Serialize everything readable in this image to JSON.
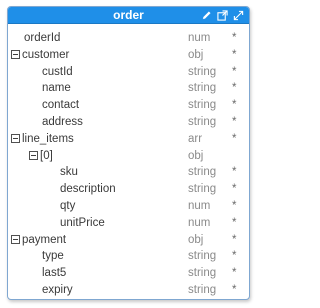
{
  "node": {
    "title": "order",
    "title_bg": "#1f8fe8",
    "border_color": "#7fa7d1",
    "toolbar_icons": [
      "pencil-icon",
      "external-link-icon",
      "expand-icon"
    ]
  },
  "fields": [
    {
      "name": "orderId",
      "type": "num",
      "req": "*",
      "depth": 0,
      "expander": false
    },
    {
      "name": "customer",
      "type": "obj",
      "req": "*",
      "depth": 0,
      "expander": true
    },
    {
      "name": "custId",
      "type": "string",
      "req": "*",
      "depth": 1,
      "expander": false
    },
    {
      "name": "name",
      "type": "string",
      "req": "*",
      "depth": 1,
      "expander": false
    },
    {
      "name": "contact",
      "type": "string",
      "req": "*",
      "depth": 1,
      "expander": false
    },
    {
      "name": "address",
      "type": "string",
      "req": "*",
      "depth": 1,
      "expander": false
    },
    {
      "name": "line_items",
      "type": "arr",
      "req": "*",
      "depth": 0,
      "expander": true
    },
    {
      "name": "[0]",
      "type": "obj",
      "req": "",
      "depth": 1,
      "expander": true
    },
    {
      "name": "sku",
      "type": "string",
      "req": "*",
      "depth": 2,
      "expander": false
    },
    {
      "name": "description",
      "type": "string",
      "req": "*",
      "depth": 2,
      "expander": false
    },
    {
      "name": "qty",
      "type": "num",
      "req": "*",
      "depth": 2,
      "expander": false
    },
    {
      "name": "unitPrice",
      "type": "num",
      "req": "*",
      "depth": 2,
      "expander": false
    },
    {
      "name": "payment",
      "type": "obj",
      "req": "*",
      "depth": 0,
      "expander": true
    },
    {
      "name": "type",
      "type": "string",
      "req": "*",
      "depth": 1,
      "expander": false
    },
    {
      "name": "last5",
      "type": "string",
      "req": "*",
      "depth": 1,
      "expander": false
    },
    {
      "name": "expiry",
      "type": "string",
      "req": "*",
      "depth": 1,
      "expander": false
    }
  ]
}
